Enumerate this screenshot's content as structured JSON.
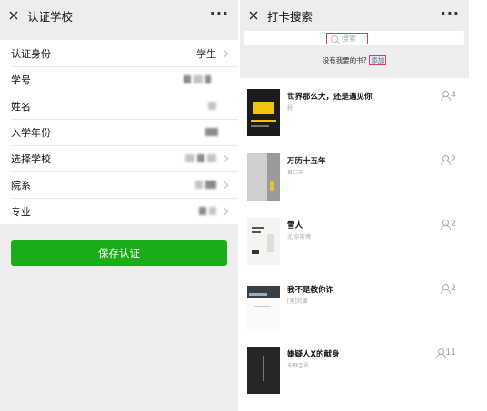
{
  "left": {
    "nav": {
      "title": "认证学校",
      "more": "···"
    },
    "form": [
      {
        "label": "认证身份",
        "value": "学生"
      },
      {
        "label": "学号",
        "value": ""
      },
      {
        "label": "姓名",
        "value": ""
      },
      {
        "label": "入学年份",
        "value": ""
      },
      {
        "label": "选择学校",
        "value": ""
      },
      {
        "label": "院系",
        "value": ""
      },
      {
        "label": "专业",
        "value": ""
      }
    ],
    "save_label": "保存认证"
  },
  "right": {
    "nav": {
      "title": "打卡搜索",
      "more": "···"
    },
    "search_placeholder": "搜索",
    "hint_text": "没有我要的书?",
    "hint_link": "添加",
    "books": [
      {
        "title": "世界那么大，还是遇见你",
        "author": "程",
        "count": "4"
      },
      {
        "title": "万历十五年",
        "author": "黄仁宇",
        "count": "2"
      },
      {
        "title": "雪人",
        "author": "尤·奈斯博",
        "count": "2"
      },
      {
        "title": "我不是教你诈",
        "author": "[美]刘墉",
        "count": "2"
      },
      {
        "title": "嫌疑人X的献身",
        "author": "东野圭吾",
        "count": "11"
      }
    ]
  },
  "colors": {
    "accent_green": "#1aad19",
    "highlight": "#e5317a",
    "link": "#576b95"
  }
}
